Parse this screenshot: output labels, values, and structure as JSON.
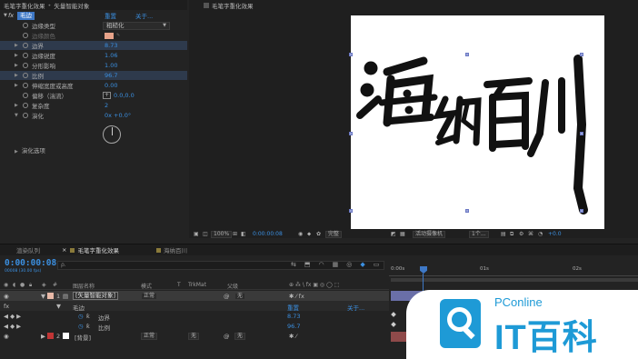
{
  "effect_controls": {
    "path_comp": "毛笔字重化效果",
    "path_sep": "•",
    "path_layer": "矢量智能对象",
    "effect_badge": "fx",
    "effect_name": "毛边",
    "reset": "重置",
    "about": "关于...",
    "props": [
      {
        "label": "边缘类型",
        "dropdown": "粗糙化"
      },
      {
        "label": "边缘颜色",
        "color": "#e7a38a",
        "dim": true
      },
      {
        "label": "边界",
        "value": "8.73"
      },
      {
        "label": "边缘锐度",
        "value": "1.06"
      },
      {
        "label": "分形影响",
        "value": "1.00"
      },
      {
        "label": "比例",
        "value": "96.7"
      },
      {
        "label": "伸缩宽度或高度",
        "value": "0.00"
      },
      {
        "label": "偏移（湍流）",
        "value": "0.0,0.0"
      },
      {
        "label": "复杂度",
        "value": "2"
      },
      {
        "label": "演化",
        "value": "0x +0.0°"
      }
    ],
    "extra": "演化选项"
  },
  "comp_viewer": {
    "tab_title": "毛笔字重化效果",
    "calligraphy": "海纳百川",
    "zoom": "100%",
    "timecode": "0:00:00:08",
    "quality": "完整",
    "camera": "活动摄像机",
    "views": "1个...",
    "exposure": "+0.0"
  },
  "timeline": {
    "tabs": [
      "渲染队列",
      "毛笔字重化效果",
      "海纳百川"
    ],
    "timecode": "0:00:00:08",
    "fps": "00008 (30.00 fps)",
    "search_placeholder": "ρ.",
    "ruler": [
      "0:00s",
      "01s",
      "02s"
    ],
    "columns": {
      "layer_name": "图层名称",
      "mode": "模式",
      "t": "T",
      "trkmat": "TrkMat",
      "parent": "父级"
    },
    "layers": [
      {
        "index": "1",
        "name": "[矢量智能对象]",
        "mode": "正常",
        "parent": "无",
        "color": "#e8b9a8",
        "selected": true
      },
      {
        "index": "2",
        "name": "[背景]",
        "mode": "正常",
        "trkmat": "无",
        "parent": "无",
        "color": "#c03535"
      }
    ],
    "effect_name": "毛边",
    "effect_reset": "重置",
    "effect_about": "关于...",
    "sub_props": [
      {
        "label": "边界",
        "value": "8.73"
      },
      {
        "label": "比例",
        "value": "96.7"
      }
    ]
  },
  "watermark": {
    "brand": "PConline",
    "title": "IT百科"
  }
}
